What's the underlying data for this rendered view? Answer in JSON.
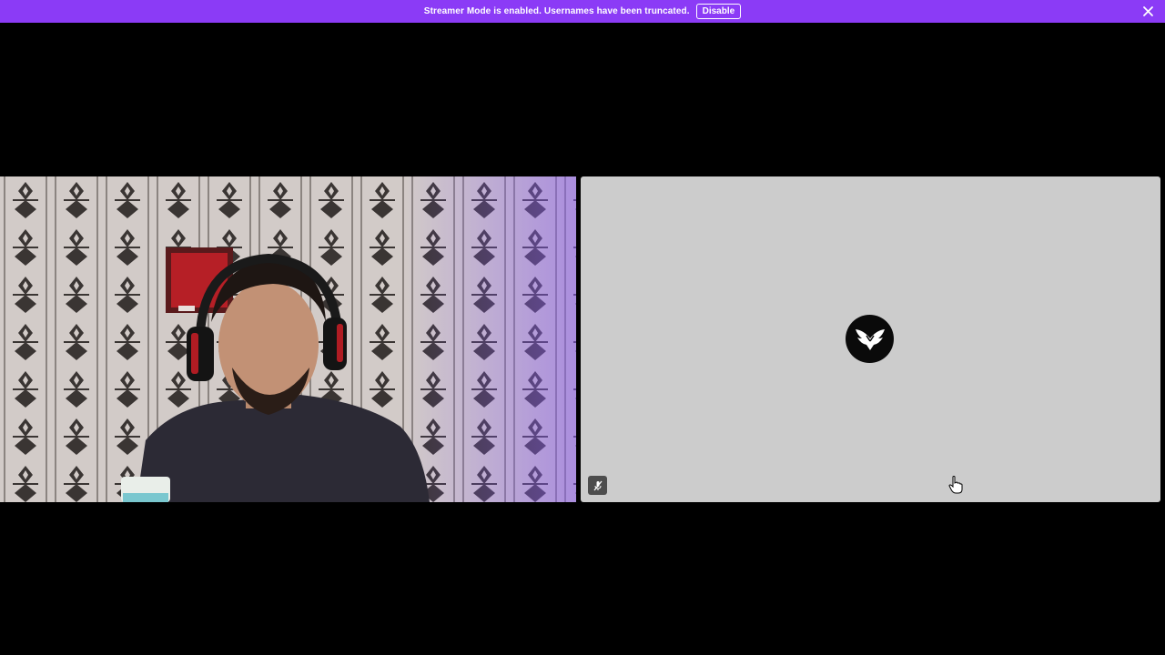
{
  "banner": {
    "message": "Streamer Mode is enabled. Usernames have been truncated.",
    "disable_label": "Disable",
    "close_icon": "close-icon",
    "color": "#8b3bf6"
  },
  "call": {
    "participants": [
      {
        "type": "video",
        "icon": "webcam-video"
      },
      {
        "type": "avatar",
        "icon": "winged-logo-icon",
        "muted": true,
        "mute_icon": "mic-muted-icon"
      }
    ]
  }
}
